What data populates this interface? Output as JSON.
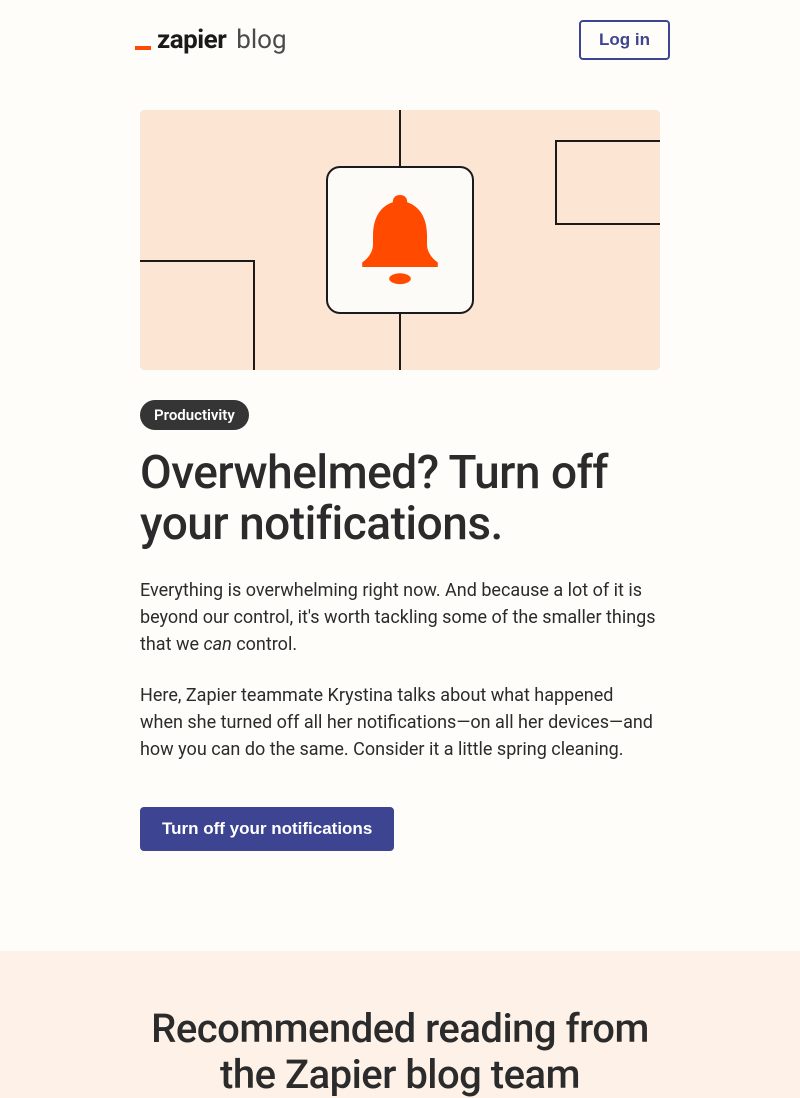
{
  "header": {
    "logo_main": "zapier",
    "logo_sub": "blog",
    "login_label": "Log in"
  },
  "article": {
    "category": "Productivity",
    "title": "Overwhelmed? Turn off your notifications.",
    "para1_a": "Everything is overwhelming right now. And because a lot of it is beyond our control, it's worth tackling some of the smaller things that we ",
    "para1_em": "can",
    "para1_b": " control.",
    "para2": "Here, Zapier teammate Krystina talks about what happened when she turned off all her notifications—on all her devices—and how you can do the same. Consider it a little spring cleaning.",
    "cta_label": "Turn off your notifications"
  },
  "recommended": {
    "heading": "Recommended reading from the Zapier blog team"
  },
  "colors": {
    "accent_orange": "#ff4a00",
    "brand_purple": "#3d4592",
    "hero_bg": "#fce5d3"
  }
}
